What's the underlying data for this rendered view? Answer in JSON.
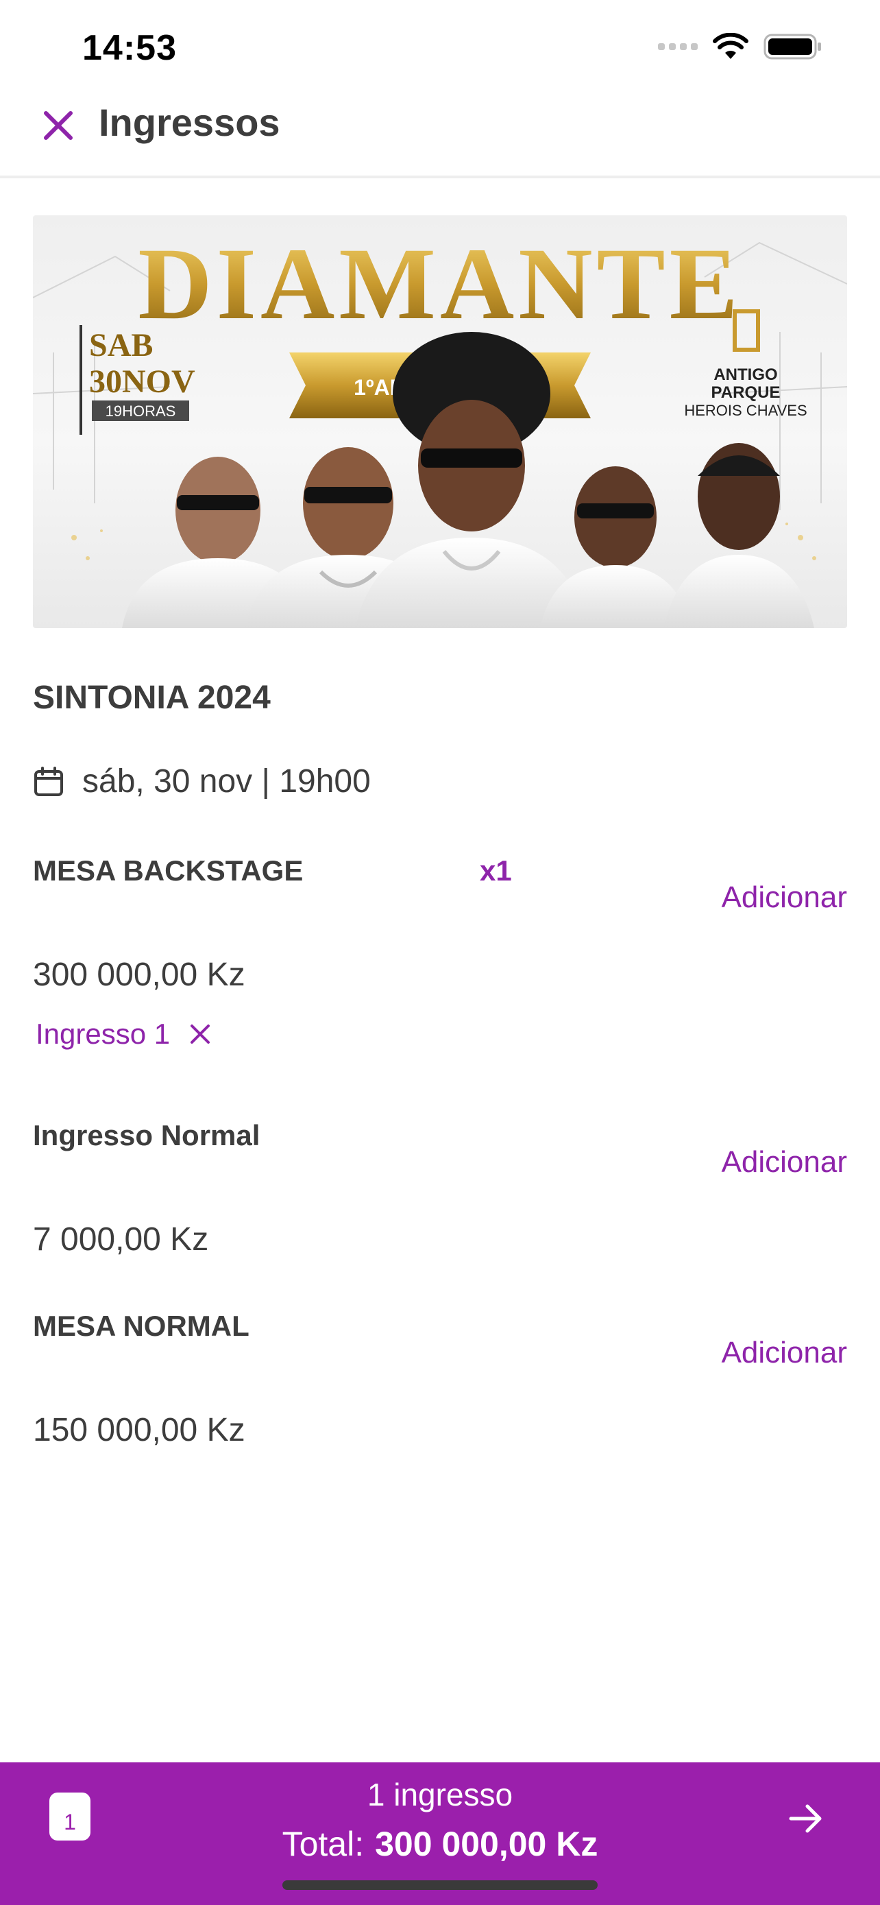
{
  "status_bar": {
    "time": "14:53"
  },
  "header": {
    "title": "Ingressos"
  },
  "banner": {
    "headline": "DIAMANTE",
    "badge": "1ºANIVERSÁRIO",
    "date_line1": "SAB",
    "date_line2": "30NOV",
    "date_time": "19HORAS",
    "venue_line1": "ANTIGO",
    "venue_line2": "PARQUE",
    "venue_line3": "HEROIS CHAVES"
  },
  "event": {
    "title": "SINTONIA 2024",
    "date": "sáb, 30 nov | 19h00"
  },
  "tickets": [
    {
      "name": "MESA BACKSTAGE",
      "quantity": "x1",
      "add_label": "Adicionar",
      "price": "300 000,00 Kz",
      "chip_label": "Ingresso 1"
    },
    {
      "name": "Ingresso Normal",
      "add_label": "Adicionar",
      "price": "7 000,00 Kz"
    },
    {
      "name": "MESA NORMAL",
      "add_label": "Adicionar",
      "price": "150 000,00 Kz"
    }
  ],
  "footer": {
    "count": "1",
    "summary": "1 ingresso",
    "total_label": "Total:",
    "total_value": "300 000,00 Kz"
  },
  "colors": {
    "accent": "#9b1fac",
    "text": "#3d3d3d"
  }
}
